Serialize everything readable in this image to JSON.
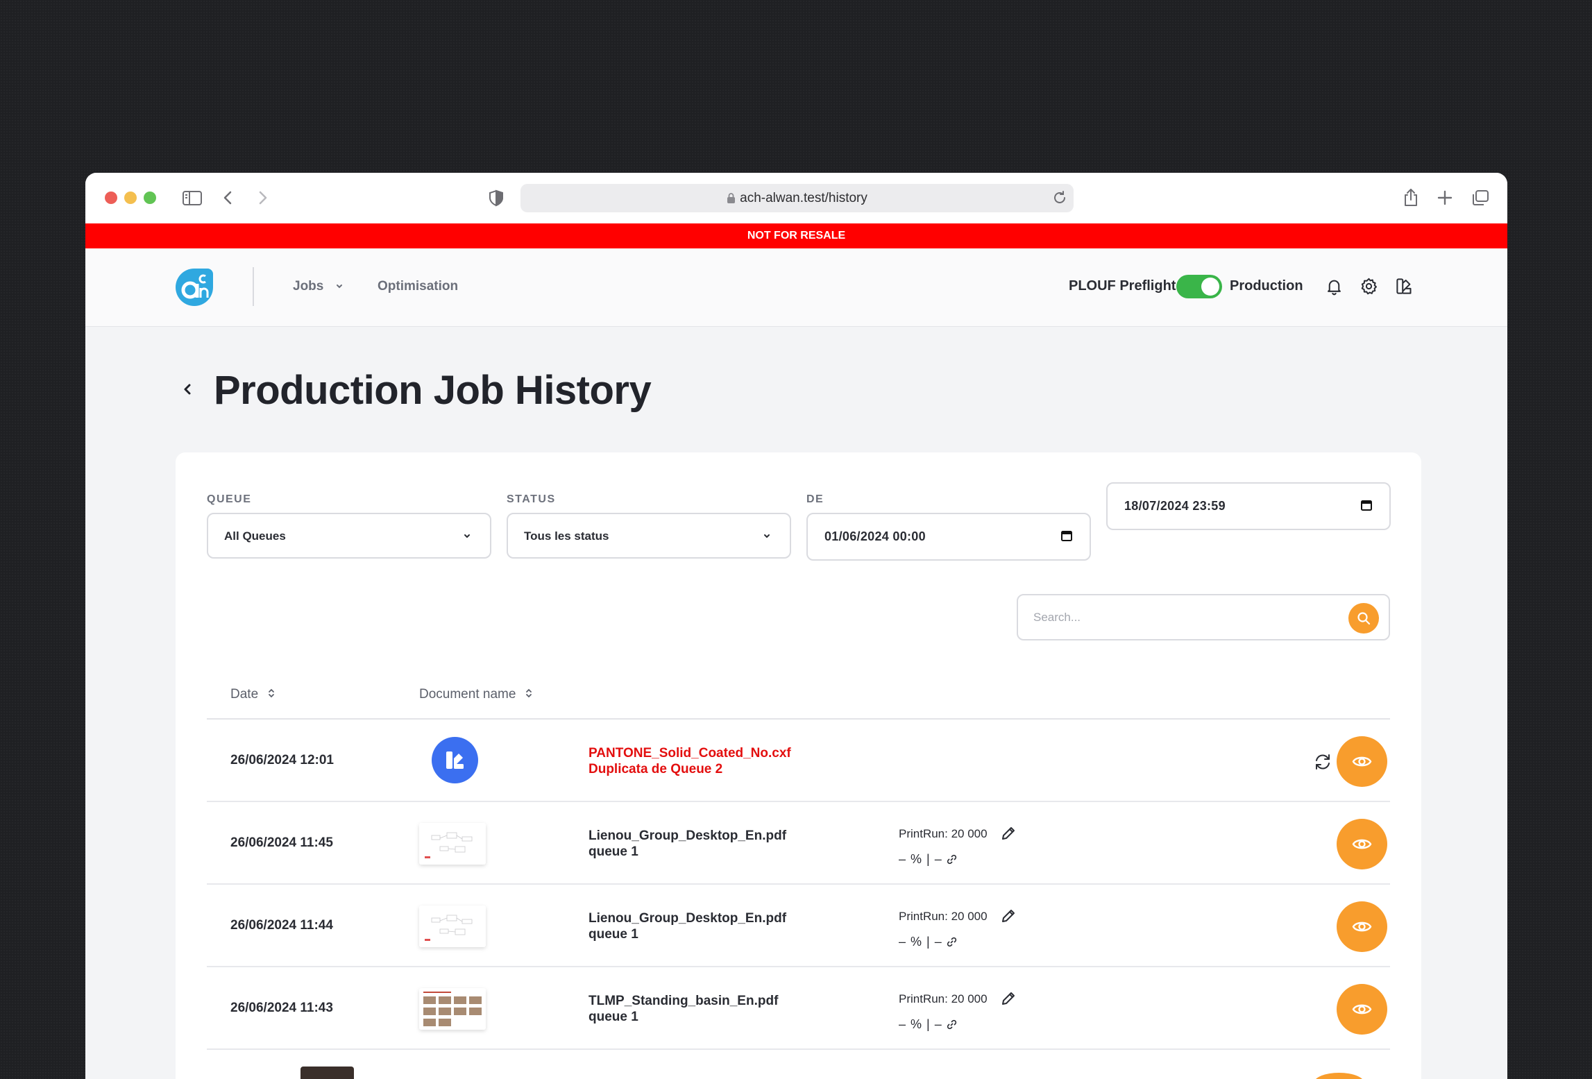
{
  "browser": {
    "url": "ach-alwan.test/history"
  },
  "banner": {
    "text": "NOT FOR RESALE"
  },
  "header": {
    "nav": [
      {
        "label": "Jobs"
      },
      {
        "label": "Optimisation"
      }
    ],
    "env_left": "PLOUF Preflight",
    "env_right": "Production",
    "toggle_on": true
  },
  "page": {
    "title": "Production Job History"
  },
  "filters": {
    "queue": {
      "label": "QUEUE",
      "value": "All Queues"
    },
    "status": {
      "label": "STATUS",
      "value": "Tous les status"
    },
    "from": {
      "label": "DE",
      "value": "01/06/2024 00:00"
    },
    "to": {
      "value": "18/07/2024 23:59"
    },
    "search": {
      "placeholder": "Search..."
    }
  },
  "table": {
    "columns": [
      "Date",
      "Document name"
    ],
    "rows": [
      {
        "date": "26/06/2024 12:01",
        "name": "PANTONE_Solid_Coated_No.cxf",
        "queue": "Duplicata de Queue 2",
        "error": true,
        "printrun": "",
        "stats": ""
      },
      {
        "date": "26/06/2024 11:45",
        "name": "Lienou_Group_Desktop_En.pdf",
        "queue": "queue 1",
        "error": false,
        "printrun": "PrintRun: 20 000",
        "stats": "–  %  |  –"
      },
      {
        "date": "26/06/2024 11:44",
        "name": "Lienou_Group_Desktop_En.pdf",
        "queue": "queue 1",
        "error": false,
        "printrun": "PrintRun: 20 000",
        "stats": "–  %  |  –"
      },
      {
        "date": "26/06/2024 11:43",
        "name": "TLMP_Standing_basin_En.pdf",
        "queue": "queue 1",
        "error": false,
        "printrun": "PrintRun: 20 000",
        "stats": "–  %  |  –"
      }
    ]
  },
  "colors": {
    "accent": "#f89d2d",
    "banner": "#ff0000",
    "error": "#e30e0e",
    "toggle": "#3ab549",
    "doc_icon": "#3b6ff0"
  },
  "icons": [
    "sidebar-icon",
    "back-icon",
    "forward-icon",
    "shield-icon",
    "lock-icon",
    "reload-icon",
    "share-icon",
    "plus-icon",
    "tabs-icon",
    "bell-icon",
    "gear-icon",
    "palette-icon",
    "search-icon",
    "eye-icon",
    "pencil-icon",
    "link-icon",
    "refresh-icon",
    "calendar-icon",
    "chevron-down-icon",
    "sort-icon"
  ]
}
